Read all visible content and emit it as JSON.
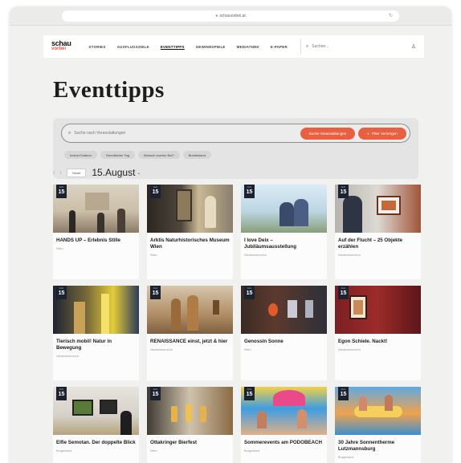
{
  "browser": {
    "url": "schauvorbei.at"
  },
  "nav": {
    "logo_top": "schau",
    "logo_bottom": "vorbei",
    "items": [
      "STORIES",
      "AUSFLUGSZIELE",
      "EVENTTIPPS",
      "GEWINNSPIELE",
      "MEDIATHEK",
      "E-PAPER"
    ],
    "active": "EVENTTIPPS",
    "search_placeholder": "Suchen..."
  },
  "page": {
    "title": "Eventtipps"
  },
  "filter": {
    "search_placeholder": "Suche nach Veranstaltungen",
    "search_button": "Suche Veranstaltungen",
    "filter_button": "Filter Verbergen",
    "tags": [
      "Indoor/Outdoor",
      "Gemütlicher Tag",
      "Wunsch suchen Bot?",
      "Bundesland"
    ]
  },
  "datebar": {
    "today_button": "Heute",
    "date": "15.August"
  },
  "events": [
    {
      "month": "AUG",
      "day": "15",
      "title": "HANDS UP – Erlebnis Stille",
      "location": "Wien"
    },
    {
      "month": "AUG",
      "day": "15",
      "title": "Arktis Naturhistorisches Museum Wien",
      "location": "Wien"
    },
    {
      "month": "AUG",
      "day": "15",
      "title": "I love Deix – Jubiläumsausstellung",
      "location": "Niederösterreich"
    },
    {
      "month": "AUG",
      "day": "15",
      "title": "Auf der Flucht – 25 Objekte erzählen",
      "location": "Niederösterreich"
    },
    {
      "month": "AUG",
      "day": "15",
      "title": "Tierisch mobil! Natur in Bewegung",
      "location": "Niederösterreich"
    },
    {
      "month": "AUG",
      "day": "15",
      "title": "RENAISSANCE einst, jetzt & hier",
      "location": "Niederösterreich"
    },
    {
      "month": "AUG",
      "day": "15",
      "title": "Genossin Sonne",
      "location": "Wien"
    },
    {
      "month": "AUG",
      "day": "15",
      "title": "Egon Schiele. Nackt!",
      "location": "Niederösterreich"
    },
    {
      "month": "AUG",
      "day": "15",
      "title": "Elfie Semotan. Der doppelte Blick",
      "location": "Burgenland"
    },
    {
      "month": "AUG",
      "day": "15",
      "title": "Ottakringer Bierfest",
      "location": "Wien"
    },
    {
      "month": "AUG",
      "day": "15",
      "title": "Sommerevents am PODOBEACH",
      "location": "Burgenland"
    },
    {
      "month": "AUG",
      "day": "15",
      "title": "30 Jahre Sonnentherme Lutzmannsburg",
      "location": "Burgenland"
    }
  ]
}
